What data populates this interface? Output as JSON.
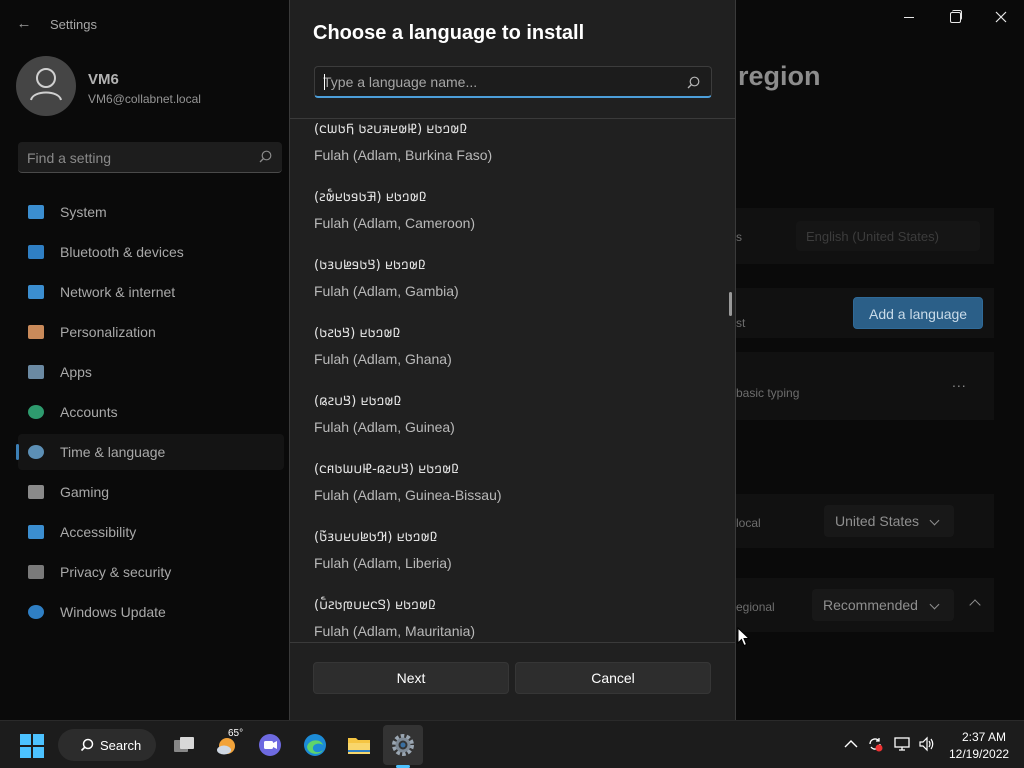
{
  "settings": {
    "app_title": "Settings",
    "user": {
      "name": "VM6",
      "email": "VM6@collabnet.local"
    },
    "search_placeholder": "Find a setting",
    "nav": [
      {
        "label": "System",
        "icon": "monitor-icon",
        "color": "#3b8ed0"
      },
      {
        "label": "Bluetooth & devices",
        "icon": "bluetooth-icon",
        "color": "#2f7fc4"
      },
      {
        "label": "Network & internet",
        "icon": "wifi-icon",
        "color": "#3b8ed0"
      },
      {
        "label": "Personalization",
        "icon": "brush-icon",
        "color": "#c98a5a"
      },
      {
        "label": "Apps",
        "icon": "apps-icon",
        "color": "#6b8aa3"
      },
      {
        "label": "Accounts",
        "icon": "person-icon",
        "color": "#2e9b6e"
      },
      {
        "label": "Time & language",
        "icon": "globe-clock-icon",
        "color": "#5c8fb5"
      },
      {
        "label": "Gaming",
        "icon": "gamepad-icon",
        "color": "#8a8a8a"
      },
      {
        "label": "Accessibility",
        "icon": "accessibility-icon",
        "color": "#3b8ed0"
      },
      {
        "label": "Privacy & security",
        "icon": "shield-icon",
        "color": "#7a7a7a"
      },
      {
        "label": "Windows Update",
        "icon": "update-icon",
        "color": "#2f7fc4"
      }
    ],
    "active_nav_index": 6,
    "heading_partial": "region",
    "display_language_partial": "s",
    "display_language_value": "English (United States)",
    "add_language_label": "Add a language",
    "preferred_partial": "st",
    "basic_typing_text": "basic typing",
    "more_label": "...",
    "country_partial": "local",
    "country_value": "United States",
    "regional_partial": "egional",
    "regional_value": "Recommended"
  },
  "dialog": {
    "title": "Choose a language to install",
    "search_placeholder": "Type a language name...",
    "languages": [
      {
        "native": "(𞤄𞤵𞤪𞤳𞤭𞤲𞤢 𞤊𞤢𞤧𞤮) 𞤆𞤵𞤤𞤢𞤪",
        "english": "Fulah (Adlam, Burkina Faso)"
      },
      {
        "native": "(𞤑𞤢𞤥𞤢𞤪𞤵𞥅𞤲) 𞤆𞤵𞤤𞤢𞤪",
        "english": "Fulah (Adlam, Cameroon)"
      },
      {
        "native": "(𞤘𞤢𞤥𞤦𞤭𞤴𞤢) 𞤆𞤵𞤤𞤢𞤪",
        "english": "Fulah (Adlam, Gambia)"
      },
      {
        "native": "(𞤘𞤢𞤲𞤢) 𞤆𞤵𞤤𞤢𞤪",
        "english": "Fulah (Adlam, Ghana)"
      },
      {
        "native": "(𞤘𞤭𞤲𞤫) 𞤆𞤵𞤤𞤢𞤪",
        "english": "Fulah (Adlam, Guinea)"
      },
      {
        "native": "(𞤘𞤭𞤲𞤫-𞤄𞤭𞤧𞤢𞤱𞤮) 𞤆𞤵𞤤𞤢𞤪",
        "english": "Fulah (Adlam, Guinea-Bissau)"
      },
      {
        "native": "(𞤂𞤢𞤦𞤭𞤪𞤭𞤴𞤢𞥄) 𞤆𞤵𞤤𞤢𞤪",
        "english": "Fulah (Adlam, Liberia)"
      },
      {
        "native": "(𞤃𞤮𞤪𞤭𞤼𞤢𞤲𞤭𞥅) 𞤆𞤵𞤤𞤢𞤪",
        "english": "Fulah (Adlam, Mauritania)"
      }
    ],
    "next_label": "Next",
    "cancel_label": "Cancel"
  },
  "taskbar": {
    "search_label": "Search",
    "weather_temp": "65°",
    "time": "2:37 AM",
    "date": "12/19/2022"
  },
  "colors": {
    "accent": "#4cc2ff",
    "dialog_bg": "#202020",
    "focus_underline": "#4c9ed9"
  }
}
